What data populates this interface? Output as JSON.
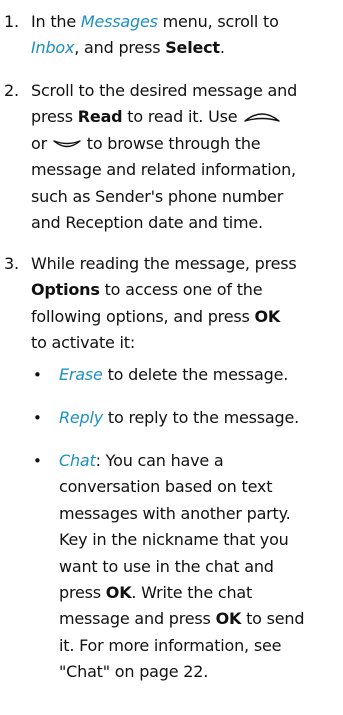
{
  "step1": {
    "number": "1.",
    "t1": "In the ",
    "messages_link": "Messages",
    "t2": " menu, scroll to",
    "inbox_link": "Inbox",
    "t3": ", and press ",
    "select_kw": "Select",
    "t4": "."
  },
  "step2": {
    "number": "2.",
    "line1": "Scroll to the desired message and",
    "t1": "press ",
    "read_kw": "Read",
    "t2": " to read it. Use ",
    "or_text": "or ",
    "t3": " to browse through the",
    "line4": "message and related information,",
    "line5": "such as Sender's phone number",
    "line6": "and Reception date and time.",
    "up_icon": "scroll-up-key-icon",
    "down_icon": "scroll-down-key-icon"
  },
  "step3": {
    "number": "3.",
    "line1": "While reading the message, press",
    "options_kw": "Options",
    "t1": " to access one of the",
    "t2": "following options, and press ",
    "ok_kw": "OK",
    "line4": "to activate it:"
  },
  "bullets": {
    "symbol": "•",
    "erase_link": "Erase",
    "erase_text": " to delete the message.",
    "reply_link": "Reply",
    "reply_text": " to reply to the message.",
    "chat_link": "Chat",
    "chat_l1": ": You can have a",
    "chat_l2": "conversation based on text",
    "chat_l3": "messages with another party.",
    "chat_l4": "Key in the nickname that you",
    "chat_l5": "want to use in the chat and",
    "chat_l6a": "press ",
    "chat_ok1": "OK",
    "chat_l6b": ". Write the chat",
    "chat_l7a": "message and press ",
    "chat_ok2": "OK",
    "chat_l7b": " to send",
    "chat_l8": "it. For more information, see",
    "chat_l9": "\"Chat\" on page 22."
  },
  "colors": {
    "link": "#1d8fc4",
    "text": "#111111"
  }
}
